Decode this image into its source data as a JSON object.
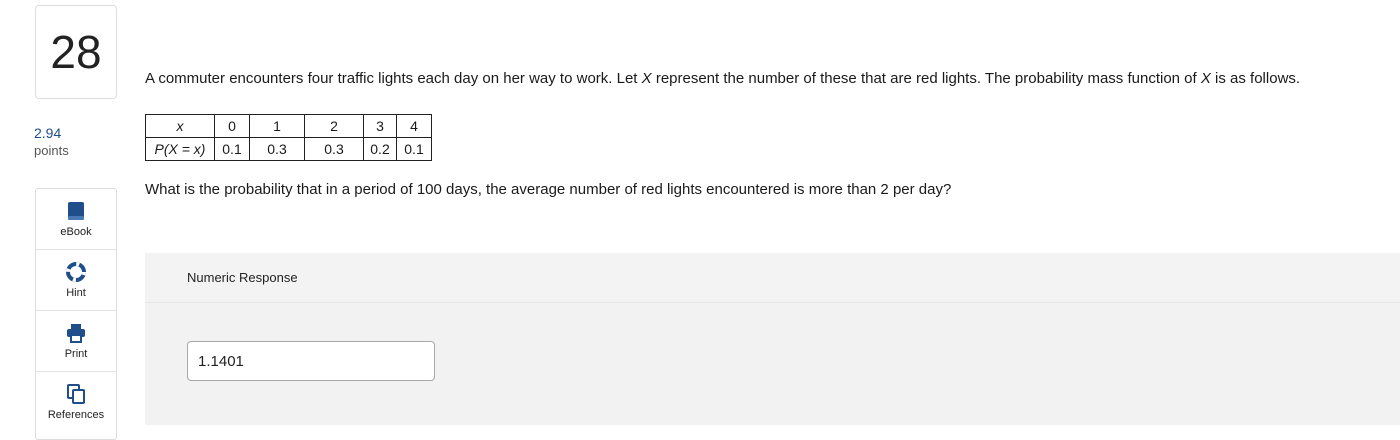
{
  "question": {
    "number": "28",
    "points_value": "2.94",
    "points_label": "points",
    "stem_part1": "A commuter encounters four traffic lights each day on her way to work. Let ",
    "var1": "X",
    "stem_part2": " represent the number of these that are red lights. The probability mass function of ",
    "var2": "X",
    "stem_part3": " is as follows.",
    "followup": "What is the probability that in a period of 100 days, the average number of red lights encountered is more than 2 per day?"
  },
  "pmf_table": {
    "header": [
      "x",
      "0",
      "1",
      "2",
      "3",
      "4"
    ],
    "row": [
      "P(X = x)",
      "0.1",
      "0.3",
      "0.3",
      "0.2",
      "0.1"
    ]
  },
  "tools": [
    {
      "label": "eBook",
      "icon": "book-icon"
    },
    {
      "label": "Hint",
      "icon": "lifebuoy-icon"
    },
    {
      "label": "Print",
      "icon": "printer-icon"
    },
    {
      "label": "References",
      "icon": "copy-icon"
    }
  ],
  "response": {
    "heading": "Numeric Response",
    "value": "1.1401"
  },
  "colors": {
    "accent": "#1f4e8a",
    "panel_bg": "#f2f2f2"
  }
}
